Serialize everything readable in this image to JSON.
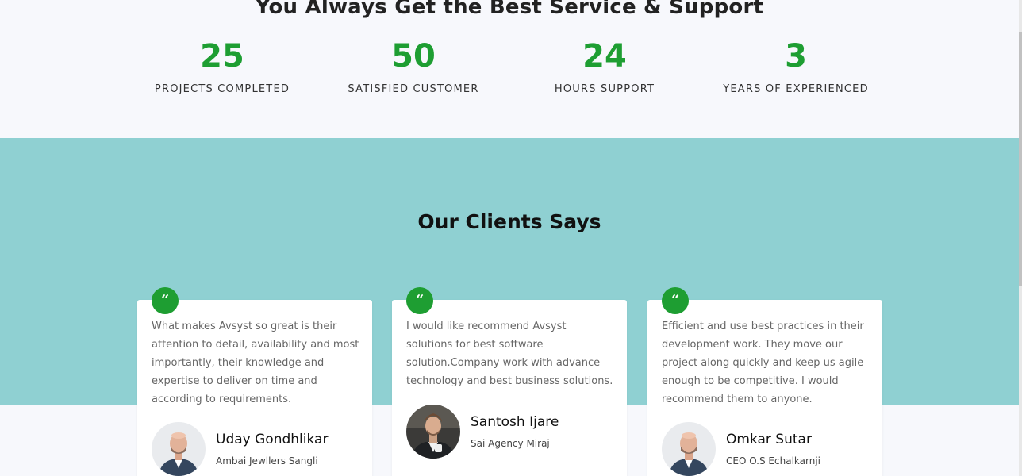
{
  "stats_section": {
    "title": "You Always Get the Best Service & Support",
    "items": [
      {
        "number": "25",
        "label": "PROJECTS COMPLETED"
      },
      {
        "number": "50",
        "label": "SATISFIED CUSTOMER"
      },
      {
        "number": "24",
        "label": "HOURS SUPPORT"
      },
      {
        "number": "3",
        "label": "YEARS OF EXPERIENCED"
      }
    ]
  },
  "clients_section": {
    "title": "Our Clients Says",
    "quote_icon": "quote-left-icon",
    "testimonials": [
      {
        "text": "What makes Avsyst so great is their attention to detail, availability and most importantly, their knowledge and expertise to deliver on time and according to requirements.",
        "name": "Uday Gondhlikar",
        "role": "Ambai Jewllers Sangli"
      },
      {
        "text": "I would like recommend Avsyst solutions for best software solution.Company work with advance technology and best business solutions.",
        "name": "Santosh Ijare",
        "role": "Sai Agency Miraj"
      },
      {
        "text": "Efficient and use best practices in their development work. They move our project along quickly and keep us agile enough to be competitive. I would recommend them to anyone.",
        "name": "Omkar Sutar",
        "role": "CEO O.S Echalkarnji"
      }
    ]
  },
  "colors": {
    "accent_green": "#1e9e32",
    "teal_background": "#8fd0d2",
    "page_background": "#f7f8fc"
  }
}
